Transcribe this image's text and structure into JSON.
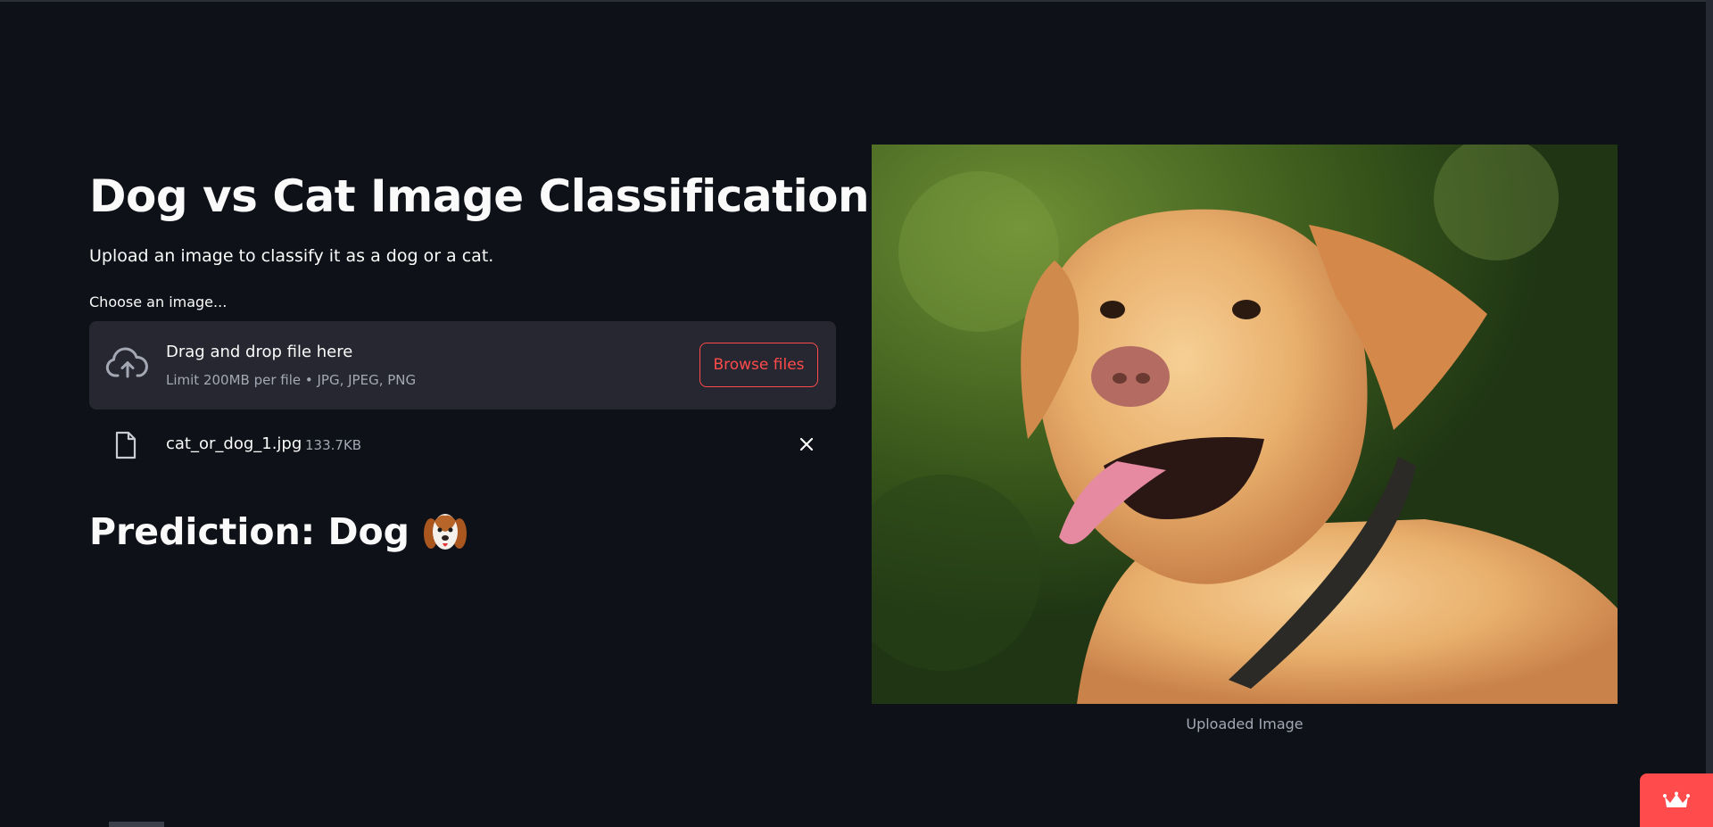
{
  "main": {
    "title": "Dog vs Cat Image Classification",
    "subtitle": "Upload an image to classify it as a dog or a cat.",
    "uploader": {
      "label": "Choose an image...",
      "dropzone_title": "Drag and drop file here",
      "dropzone_limit": "Limit 200MB per file • JPG, JPEG, PNG",
      "browse_label": "Browse files",
      "file": {
        "name": "cat_or_dog_1.jpg",
        "size": "133.7KB"
      }
    },
    "prediction": "Prediction: Dog",
    "image_caption": "Uploaded Image"
  },
  "colors": {
    "background": "#0e1117",
    "accent": "#ff4b4b",
    "dropzone": "#262730",
    "muted_text": "#a3a8b4"
  },
  "icons": [
    "upload-cloud-icon",
    "file-icon",
    "close-icon",
    "dog-face-icon",
    "crown-icon"
  ]
}
